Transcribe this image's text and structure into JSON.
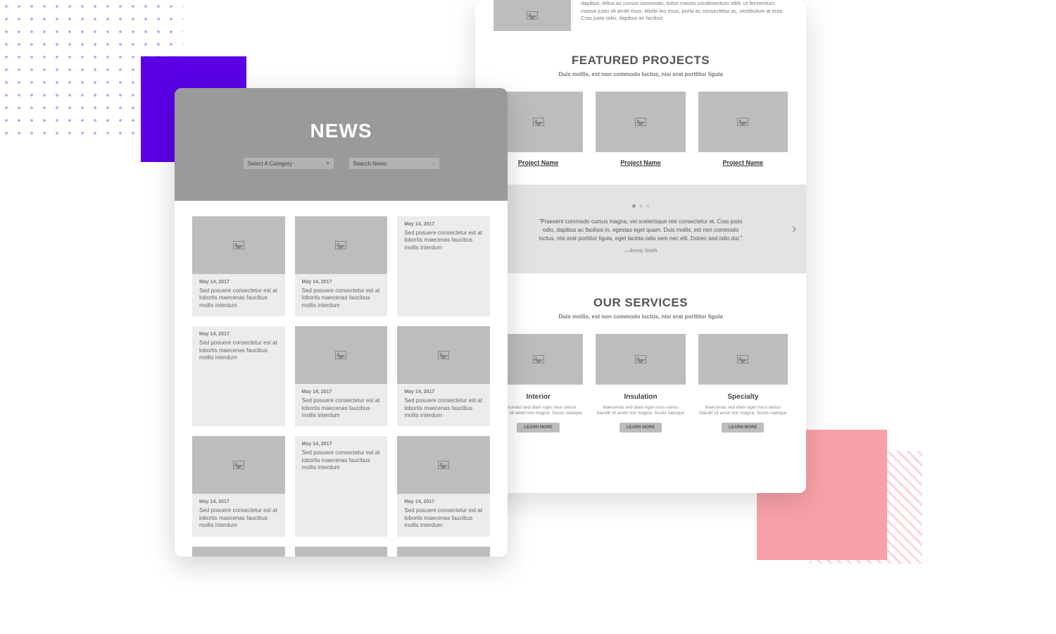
{
  "newsMockup": {
    "title": "NEWS",
    "categorySelect": {
      "placeholder": "Select A Category"
    },
    "search": {
      "placeholder": "Search News"
    },
    "cards": [
      {
        "date": "May 14, 2017",
        "excerpt": "Sed posuere consectetur est at lobortis maecenas faucibus mollis interdum",
        "hasImage": true
      },
      {
        "date": "May 14, 2017",
        "excerpt": "Sed posuere consectetur est at lobortis maecenas faucibus mollis interdum",
        "hasImage": true
      },
      {
        "date": "May 14, 2017",
        "excerpt": "Sed posuere consectetur est at lobortis maecenas faucibus mollis interdum",
        "hasImage": false
      },
      {
        "date": "May 14, 2017",
        "excerpt": "Sed posuere consectetur est at lobortis maecenas faucibus mollis interdum",
        "hasImage": false
      },
      {
        "date": "May 14, 2017",
        "excerpt": "Sed posuere consectetur est at lobortis maecenas faucibus mollis interdum",
        "hasImage": true
      },
      {
        "date": "May 14, 2017",
        "excerpt": "Sed posuere consectetur est at lobortis maecenas faucibus mollis interdum",
        "hasImage": true
      },
      {
        "date": "May 14, 2017",
        "excerpt": "Sed posuere consectetur est at lobortis maecenas faucibus mollis interdum",
        "hasImage": true
      },
      {
        "date": "May 14, 2017",
        "excerpt": "Sed posuere consectetur est at lobortis maecenas faucibus mollis interdum",
        "hasImage": false
      },
      {
        "date": "May 14, 2017",
        "excerpt": "Sed posuere consectetur est at lobortis maecenas faucibus mollis interdum",
        "hasImage": true
      }
    ]
  },
  "projectsMockup": {
    "hero": {
      "text": "dapibus, tellus ac cursus commodo, tortor mauris condimentum nibh, ut fermentum massa justo sit amet risus. Morbi leo risus, porta ac consectetur ac, vestibulum at eros. Cras justo odio, dapibus ac facilisis"
    },
    "featured": {
      "title": "FEATURED PROJECTS",
      "subtitle": "Duis mollis, est non commodo luctus, nisi erat porttitor ligula",
      "items": [
        {
          "name": "Project Name"
        },
        {
          "name": "Project Name"
        },
        {
          "name": "Project Name"
        }
      ]
    },
    "quote": {
      "text": "\"Praesent commodo cursus magna, vel scelerisque nisl consectetur et. Cras justo odio, dapibus ac facilisis in, egestas eget quam. Duis mollis, est non commodo luctus, nisi erat porttitor ligula, eget lacinia odio sem nec elit. Donec sed odio dui.\"",
      "author": "—Jimmy Smith"
    },
    "services": {
      "title": "OUR SERVICES",
      "subtitle": "Duis mollis, est non commodo luctus, nisi erat porttitor ligula",
      "items": [
        {
          "name": "Interior",
          "desc": "Maecenas sed diam eget risus varius blandit sit amet non magna. Sociis natoque",
          "btn": "LEARN MORE"
        },
        {
          "name": "Insulation",
          "desc": "Maecenas sed diam eget risus varius blandit sit amet non magna. Sociis natoque",
          "btn": "LEARN MORE"
        },
        {
          "name": "Specialty",
          "desc": "Maecenas sed diam eget risus varius blandit sit amet non magna. Sociis natoque",
          "btn": "LEARN MORE"
        }
      ]
    }
  }
}
